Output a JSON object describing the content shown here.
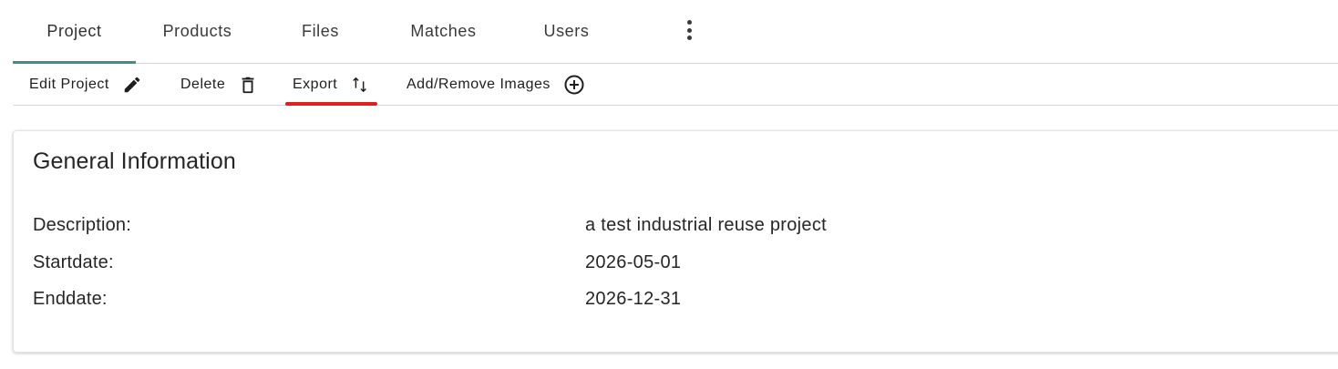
{
  "tabs": [
    {
      "label": "Project",
      "active": true
    },
    {
      "label": "Products",
      "active": false
    },
    {
      "label": "Files",
      "active": false
    },
    {
      "label": "Matches",
      "active": false
    },
    {
      "label": "Users",
      "active": false
    }
  ],
  "tabs_more_icon": "more-vertical-icon",
  "toolbar": {
    "edit_label": "Edit Project",
    "edit_icon": "pencil-icon",
    "delete_label": "Delete",
    "delete_icon": "trash-icon",
    "export_label": "Export",
    "export_icon": "swap-vertical-icon",
    "images_label": "Add/Remove Images",
    "images_icon": "plus-circle-icon"
  },
  "colors": {
    "active_tab_indicator": "#3f8f83",
    "highlight_underline": "#e02020"
  },
  "card": {
    "title": "General Information",
    "fields": [
      {
        "label": "Description:",
        "value": "a test industrial reuse project"
      },
      {
        "label": "Startdate:",
        "value": "2026-05-01"
      },
      {
        "label": "Enddate:",
        "value": "2026-12-31"
      }
    ]
  }
}
